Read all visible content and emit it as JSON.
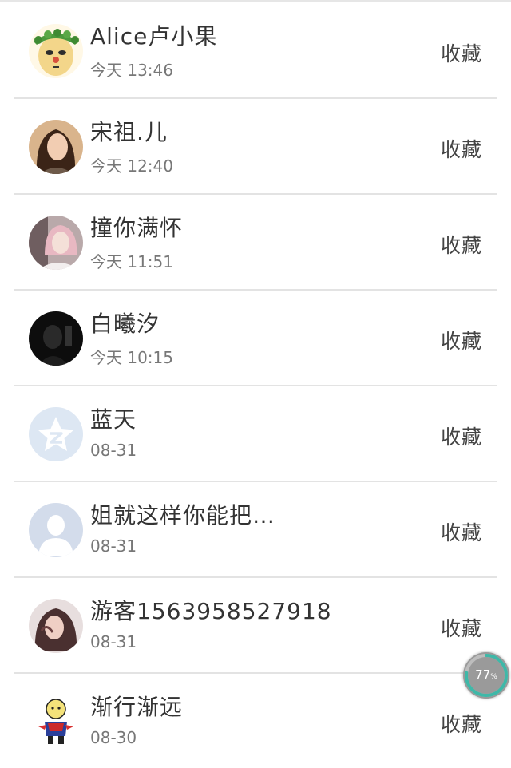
{
  "items": [
    {
      "name": "Alice卢小果",
      "time": "今天 13:46",
      "action": "收藏",
      "avatar": "leaf-crown-cartoon-avatar"
    },
    {
      "name": "宋祖.儿",
      "time": "今天 12:40",
      "action": "收藏",
      "avatar": "woman-photo-avatar"
    },
    {
      "name": "撞你满怀",
      "time": "今天 11:51",
      "action": "收藏",
      "avatar": "pink-hair-photo-avatar"
    },
    {
      "name": "白曦汐",
      "time": "今天 10:15",
      "action": "收藏",
      "avatar": "dark-photo-avatar"
    },
    {
      "name": "蓝天",
      "time": "08-31",
      "action": "收藏",
      "avatar": "qzone-star-avatar"
    },
    {
      "name": "姐就这样你能把…",
      "time": "08-31",
      "action": "收藏",
      "avatar": "default-person-avatar"
    },
    {
      "name": "游客1563958527918",
      "time": "08-31",
      "action": "收藏",
      "avatar": "girl-photo-avatar"
    },
    {
      "name": "渐行渐远",
      "time": "08-30",
      "action": "收藏",
      "avatar": "cartoon-character-avatar"
    }
  ],
  "float_badge": {
    "value": "77",
    "unit": "%",
    "progress": 0.77,
    "ring_color": "#3fb8a8"
  }
}
